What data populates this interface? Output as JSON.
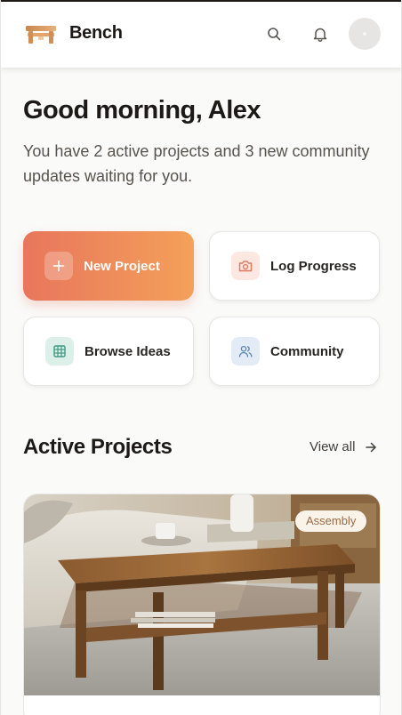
{
  "app": {
    "brand": "Bench"
  },
  "header": {
    "search_icon": "search-icon",
    "notification_icon": "bell-icon",
    "avatar": "user-avatar"
  },
  "hero": {
    "greeting": "Good morning, Alex",
    "subtitle": "You have 2 active projects and 3 new community updates waiting for you."
  },
  "actions": [
    {
      "label": "New Project",
      "icon": "plus-icon"
    },
    {
      "label": "Log Progress",
      "icon": "camera-icon"
    },
    {
      "label": "Browse Ideas",
      "icon": "grid-icon"
    },
    {
      "label": "Community",
      "icon": "users-icon"
    }
  ],
  "projects": {
    "title": "Active Projects",
    "view_all": "View all",
    "items": [
      {
        "badge": "Assembly",
        "image": "wooden-coffee-table-photo"
      }
    ]
  },
  "colors": {
    "accent_start": "#e8765c",
    "accent_end": "#f4a05a",
    "text": "#1c1917",
    "muted": "#57534e"
  }
}
